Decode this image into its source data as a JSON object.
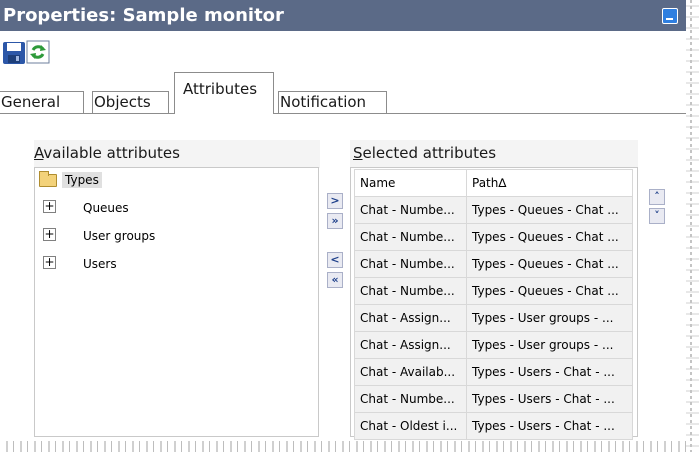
{
  "window": {
    "title": "Properties: Sample monitor",
    "accent": "#5b6a87"
  },
  "toolbar": {
    "save_icon": "save-icon",
    "refresh_icon": "refresh-icon"
  },
  "tabs": [
    {
      "label": "General"
    },
    {
      "label": "Objects"
    },
    {
      "label": "Attributes",
      "selected": true
    },
    {
      "label": "Notification"
    }
  ],
  "available": {
    "label_first": "A",
    "label_rest": "vailable attributes",
    "tree": {
      "root": "Types",
      "children": [
        "Queues",
        "User groups",
        "Users"
      ]
    }
  },
  "move_buttons": {
    "add": ">",
    "add_all": "»",
    "remove": "<",
    "remove_all": "«"
  },
  "order_buttons": {
    "up": "˄",
    "down": "˅"
  },
  "selected": {
    "label_first": "S",
    "label_rest": "elected attributes",
    "columns": [
      "Name",
      "Path∆"
    ],
    "rows": [
      [
        "Chat - Numbe...",
        "Types - Queues - Chat ..."
      ],
      [
        "Chat - Numbe...",
        "Types - Queues - Chat ..."
      ],
      [
        "Chat - Numbe...",
        "Types - Queues - Chat ..."
      ],
      [
        "Chat - Numbe...",
        "Types - Queues - Chat ..."
      ],
      [
        "Chat - Assign...",
        "Types - User groups - ..."
      ],
      [
        "Chat - Assign...",
        "Types - User groups - ..."
      ],
      [
        "Chat - Availab...",
        "Types - Users - Chat - ..."
      ],
      [
        "Chat - Numbe...",
        "Types - Users - Chat - ..."
      ],
      [
        "Chat - Oldest i...",
        "Types - Users - Chat - ..."
      ]
    ]
  }
}
